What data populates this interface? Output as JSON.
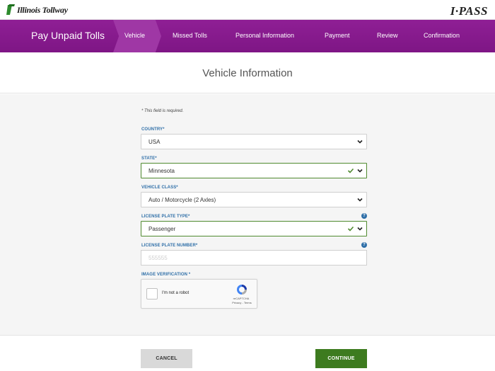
{
  "header": {
    "logo_text": "Illinois Tollway",
    "brand_right": "I·PASS"
  },
  "nav": {
    "title": "Pay Unpaid Tolls",
    "steps": [
      {
        "label": "Vehicle",
        "active": true
      },
      {
        "label": "Missed Tolls",
        "active": false
      },
      {
        "label": "Personal Information",
        "active": false
      },
      {
        "label": "Payment",
        "active": false
      },
      {
        "label": "Review",
        "active": false
      },
      {
        "label": "Confirmation",
        "active": false
      }
    ]
  },
  "page": {
    "heading": "Vehicle Information"
  },
  "form": {
    "required_note": "* This field is required.",
    "country": {
      "label": "COUNTRY*",
      "value": "USA"
    },
    "state": {
      "label": "STATE*",
      "value": "Minnesota"
    },
    "vehicle_class": {
      "label": "VEHICLE CLASS*",
      "value": "Auto / Motorcycle (2 Axles)"
    },
    "plate_type": {
      "label": "LICENSE PLATE TYPE*",
      "value": "Passenger"
    },
    "plate_number": {
      "label": "LICENSE PLATE NUMBER*",
      "placeholder": "555555",
      "value": ""
    },
    "image_verification": {
      "label": "IMAGE VERIFICATION *"
    }
  },
  "captcha": {
    "label": "I'm not a robot",
    "brand": "reCAPTCHA",
    "links": "Privacy - Terms"
  },
  "buttons": {
    "cancel": "CANCEL",
    "continue": "CONTINUE"
  },
  "colors": {
    "nav_purple": "#8f1f95",
    "active_step": "#9f37a5",
    "label_blue": "#2f6fa8",
    "valid_green": "#4f8a2f",
    "continue_green": "#3d7b1f"
  }
}
